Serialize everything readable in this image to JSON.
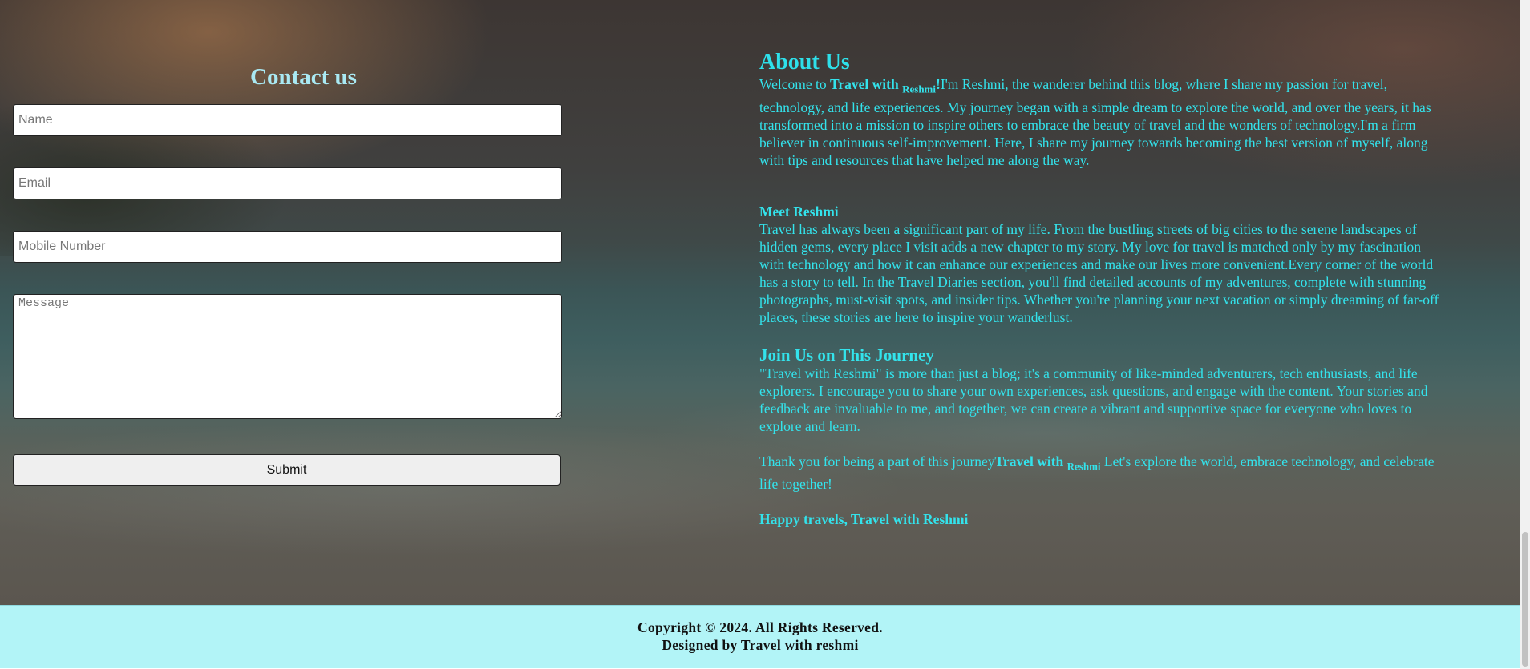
{
  "contact": {
    "title": "Contact us",
    "name_placeholder": "Name",
    "email_placeholder": "Email",
    "mobile_placeholder": "Mobile Number",
    "message_placeholder": "Message",
    "submit_label": "Submit"
  },
  "about": {
    "title": "About Us",
    "intro_prefix": "Welcome to ",
    "brand_main": "Travel with ",
    "brand_sub": "Reshmi",
    "brand_bang": "!",
    "intro_text": "I'm Reshmi, the wanderer behind this blog, where I share my passion for travel, technology, and life experiences. My journey began with a simple dream to explore the world, and over the years, it has transformed into a mission to inspire others to embrace the beauty of travel and the wonders of technology.I'm a firm believer in continuous self-improvement. Here, I share my journey towards becoming the best version of myself, along with tips and resources that have helped me along the way.",
    "meet_title": "Meet Reshmi",
    "meet_text": "Travel has always been a significant part of my life. From the bustling streets of big cities to the serene landscapes of hidden gems, every place I visit adds a new chapter to my story. My love for travel is matched only by my fascination with technology and how it can enhance our experiences and make our lives more convenient.Every corner of the world has a story to tell. In the Travel Diaries section, you'll find detailed accounts of my adventures, complete with stunning photographs, must-visit spots, and insider tips. Whether you're planning your next vacation or simply dreaming of far-off places, these stories are here to inspire your wanderlust.",
    "join_title": "Join Us on This Journey",
    "join_text": "\"Travel with Reshmi\" is more than just a blog; it's a community of like-minded adventurers, tech enthusiasts, and life explorers. I encourage you to share your own experiences, ask questions, and engage with the content. Your stories and feedback are invaluable to me, and together, we can create a vibrant and supportive space for everyone who loves to explore and learn.",
    "thanks_prefix": "Thank you for being a part of this journey",
    "thanks_brand_main": "Travel with ",
    "thanks_brand_sub": "Reshmi",
    "thanks_suffix": " Let's explore the world, embrace technology, and celebrate life together!",
    "happy": "Happy travels, Travel with Reshmi"
  },
  "footer": {
    "copyright": "Copyright © 2024. All Rights Reserved.",
    "designed_by": "Designed by Travel with reshmi"
  },
  "colors": {
    "accent_cyan": "#33e3ec",
    "heading_light_cyan": "#a9e9f3",
    "footer_bg": "#b2f4f7"
  }
}
